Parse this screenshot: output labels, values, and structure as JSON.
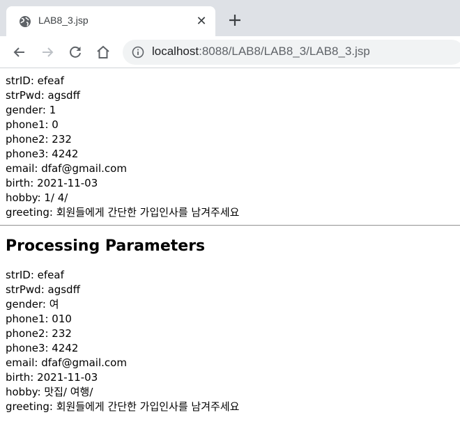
{
  "browser": {
    "tab_title": "LAB8_3.jsp",
    "close_glyph": "✕",
    "url_host": "localhost",
    "url_rest": ":8088/LAB8/LAB8_3/LAB8_3.jsp",
    "icons": [
      "globe-icon",
      "close-icon",
      "plus-icon",
      "back-arrow-icon",
      "forward-arrow-icon",
      "reload-icon",
      "home-icon",
      "info-icon"
    ]
  },
  "raw_params": [
    "strID: efeaf",
    "strPwd: agsdff",
    "gender: 1",
    "phone1: 0",
    "phone2: 232",
    "phone3: 4242",
    "email: dfaf@gmail.com",
    "birth: 2021-11-03",
    "hobby: 1/ 4/",
    "greeting: 회원들에게 간단한 가입인사를 남겨주세요"
  ],
  "heading": "Processing Parameters",
  "processed_params": [
    "strID: efeaf",
    "strPwd: agsdff",
    "gender: 여",
    "phone1: 010",
    "phone2: 232",
    "phone3: 4242",
    "email: dfaf@gmail.com",
    "birth: 2021-11-03",
    "hobby: 맛집/ 여행/",
    "greeting: 회원들에게 간단한 가입인사를 남겨주세요"
  ]
}
